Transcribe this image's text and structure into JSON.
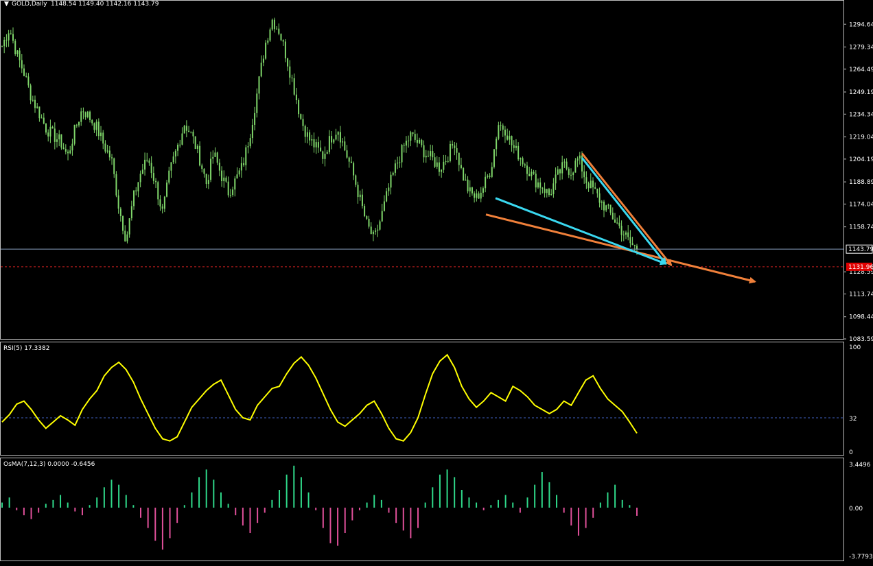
{
  "header": {
    "symbol": "GOLD,Daily",
    "ohlc": "1148.54 1149.40 1142.16 1143.79"
  },
  "colors": {
    "background": "#000000",
    "grid": "#c0c0c0",
    "candle": "#7fd66a",
    "rsi_line": "#ffff00",
    "osma_pos": "#2fd98a",
    "osma_neg": "#e0509a",
    "bid_line": "#8aa0c0",
    "dashed_level": "#d02020",
    "arrow_orange": "#f0803a",
    "arrow_cyan": "#3ad8f0"
  },
  "price_axis": {
    "ticks": [
      "1294.64",
      "1279.34",
      "1264.49",
      "1249.19",
      "1234.34",
      "1219.04",
      "1204.19",
      "1188.89",
      "1174.04",
      "1158.74",
      "1128.59",
      "1113.74",
      "1098.44",
      "1083.59"
    ],
    "current_price": "1143.79",
    "marked_price": "1131.96"
  },
  "rsi": {
    "label": "RSI(5) 17.3382",
    "ticks": [
      "100",
      "32",
      "0"
    ]
  },
  "osma": {
    "label": "OsMA(7,12,3) 0.0000 -0.6456",
    "ticks": [
      "3.4496",
      "0.00",
      "-3.7793"
    ]
  },
  "chart_data": {
    "type": "candlestick",
    "instrument": "GOLD",
    "timeframe": "Daily",
    "ohlc_last": {
      "open": 1148.54,
      "high": 1149.4,
      "low": 1142.16,
      "close": 1143.79
    },
    "price_range": [
      1083.59,
      1309.94
    ],
    "close_path": [
      1280,
      1292,
      1275,
      1262,
      1246,
      1236,
      1225,
      1220,
      1216,
      1206,
      1224,
      1238,
      1232,
      1225,
      1213,
      1204,
      1172,
      1150,
      1178,
      1195,
      1205,
      1188,
      1168,
      1196,
      1212,
      1228,
      1220,
      1206,
      1188,
      1208,
      1194,
      1182,
      1190,
      1200,
      1222,
      1250,
      1280,
      1298,
      1290,
      1272,
      1252,
      1230,
      1218,
      1212,
      1206,
      1218,
      1225,
      1210,
      1196,
      1178,
      1160,
      1150,
      1166,
      1185,
      1200,
      1212,
      1220,
      1215,
      1208,
      1204,
      1198,
      1206,
      1216,
      1195,
      1182,
      1178,
      1186,
      1198,
      1228,
      1224,
      1212,
      1206,
      1198,
      1190,
      1186,
      1180,
      1192,
      1200,
      1196,
      1205,
      1190,
      1184,
      1176,
      1170,
      1163,
      1156,
      1148,
      1143.79
    ],
    "trendlines": [
      {
        "color": "orange",
        "from": [
          "start",
          1167
        ],
        "to": [
          "end",
          1122
        ]
      },
      {
        "color": "orange",
        "from": [
          "start",
          1208
        ],
        "to": [
          "end",
          1133
        ]
      },
      {
        "color": "cyan",
        "from": [
          "start",
          1178
        ],
        "to": [
          "end",
          1134
        ]
      },
      {
        "color": "cyan",
        "from": [
          "start",
          1205
        ],
        "to": [
          "end",
          1134
        ]
      }
    ],
    "rsi": {
      "period": 5,
      "value": 17.3382,
      "level": 32,
      "range": [
        0,
        100
      ],
      "values": [
        28,
        35,
        45,
        48,
        40,
        30,
        22,
        28,
        34,
        30,
        25,
        40,
        50,
        58,
        72,
        80,
        85,
        78,
        66,
        50,
        36,
        22,
        12,
        10,
        14,
        28,
        42,
        50,
        58,
        64,
        68,
        54,
        40,
        32,
        30,
        44,
        52,
        60,
        62,
        74,
        84,
        90,
        82,
        70,
        55,
        40,
        28,
        24,
        30,
        36,
        44,
        48,
        36,
        22,
        12,
        10,
        18,
        32,
        54,
        74,
        86,
        92,
        80,
        62,
        50,
        42,
        48,
        56,
        52,
        48,
        62,
        58,
        52,
        44,
        40,
        36,
        40,
        48,
        44,
        56,
        68,
        72,
        60,
        50,
        44,
        38,
        28,
        17.3382
      ]
    },
    "osma": {
      "params": [
        7,
        12,
        3
      ],
      "value": -0.6456,
      "range": [
        -3.7793,
        3.4496
      ],
      "values": [
        0.4,
        0.8,
        -0.2,
        -0.6,
        -0.9,
        -0.4,
        0.3,
        0.6,
        1.0,
        0.4,
        -0.3,
        -0.6,
        0.2,
        0.8,
        1.6,
        2.2,
        1.8,
        1.0,
        0.2,
        -0.8,
        -1.6,
        -2.6,
        -3.3,
        -2.4,
        -1.2,
        0.2,
        1.2,
        2.4,
        3.0,
        2.2,
        1.2,
        0.3,
        -0.6,
        -1.4,
        -2.0,
        -1.2,
        -0.4,
        0.6,
        1.4,
        2.6,
        3.3,
        2.4,
        1.2,
        -0.2,
        -1.6,
        -2.8,
        -3.0,
        -2.0,
        -1.0,
        -0.2,
        0.4,
        1.0,
        0.6,
        -0.4,
        -1.2,
        -1.8,
        -2.4,
        -1.6,
        0.4,
        1.6,
        2.6,
        3.0,
        2.4,
        1.4,
        0.8,
        0.4,
        -0.2,
        0.2,
        0.6,
        1.0,
        0.4,
        -0.4,
        0.8,
        1.8,
        2.8,
        2.0,
        1.0,
        -0.4,
        -1.4,
        -2.2,
        -1.6,
        -0.8,
        0.4,
        1.2,
        1.8,
        0.6,
        0.2,
        -0.6456
      ]
    }
  }
}
